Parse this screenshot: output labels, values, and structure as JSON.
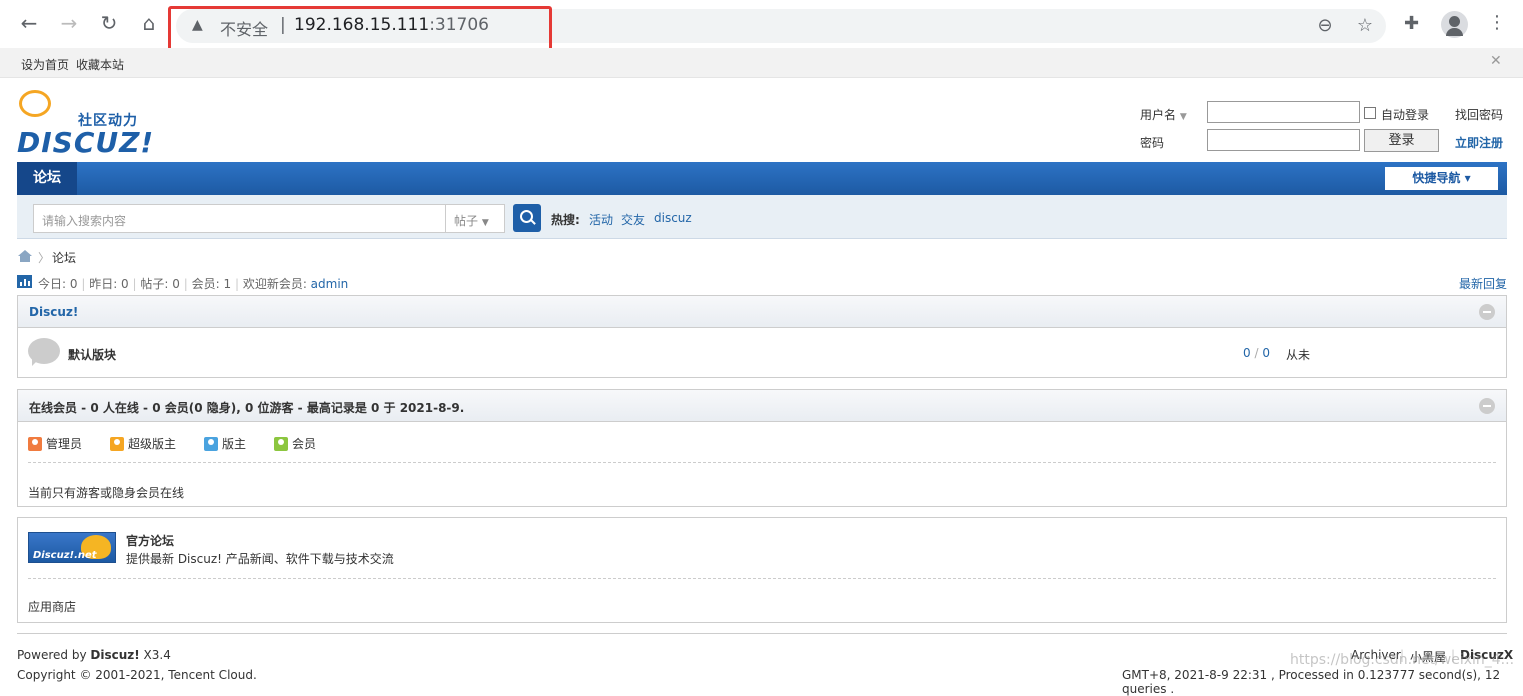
{
  "browser": {
    "insecure_label": "不安全",
    "separator": "|",
    "host": "192.168.15.111",
    "port": ":31706"
  },
  "topbar": {
    "set_home": "设为首页",
    "bookmark": "收藏本站"
  },
  "logo": {
    "slogan": "社区动力",
    "wordmark": "DISCUZ!"
  },
  "login": {
    "username_label": "用户名",
    "password_label": "密码",
    "auto_login": "自动登录",
    "find_password": "找回密码",
    "login_button": "登录",
    "register": "立即注册"
  },
  "nav": {
    "current": "论坛",
    "quick_nav": "快捷导航 ▾"
  },
  "search": {
    "placeholder": "请输入搜索内容",
    "type": "帖子",
    "hot_label": "热搜:",
    "hot_links": [
      "活动",
      "交友",
      "discuz"
    ]
  },
  "breadcrumb": {
    "current": "论坛"
  },
  "stats": {
    "text_today": "今日: 0",
    "text_yesterday": "昨日: 0",
    "text_posts": "帖子: 0",
    "text_members": "会员: 1",
    "welcome": "欢迎新会员: ",
    "new_member": "admin",
    "latest_reply": "最新回复",
    "divider": "|"
  },
  "category": {
    "title": "Discuz!",
    "forum_name": "默认版块",
    "threads": "0",
    "slash": " / ",
    "posts": "0",
    "last_post": "从未"
  },
  "online": {
    "title": "在线会员 - 0 人在线 - 0 会员(0 隐身), 0 位游客 - 最高记录是 0 于 2021-8-9.",
    "legend": [
      {
        "label": "管理员",
        "color": "#f07b3f"
      },
      {
        "label": "超级版主",
        "color": "#f5a623"
      },
      {
        "label": "版主",
        "color": "#4aa3df"
      },
      {
        "label": "会员",
        "color": "#8cc63f"
      }
    ],
    "message": "当前只有游客或隐身会员在线"
  },
  "partner": {
    "logo_text": "Discuz!.net",
    "title": "官方论坛",
    "desc": "提供最新 Discuz! 产品新闻、软件下载与技术交流",
    "appstore": "应用商店"
  },
  "footer": {
    "powered_prefix": "Powered by ",
    "powered_brand": "Discuz!",
    "version": " X3.4",
    "copyright": "Copyright © 2001-2021, Tencent Cloud.",
    "archiver": "Archiver",
    "blackroom": "小黑屋",
    "discuzx": "DiscuzX",
    "pipe": "|",
    "processed": "GMT+8, 2021-8-9 22:31 , Processed in 0.123777 second(s), 12 queries ."
  },
  "watermark": "https://blog.csdn.net/weixin_4..."
}
